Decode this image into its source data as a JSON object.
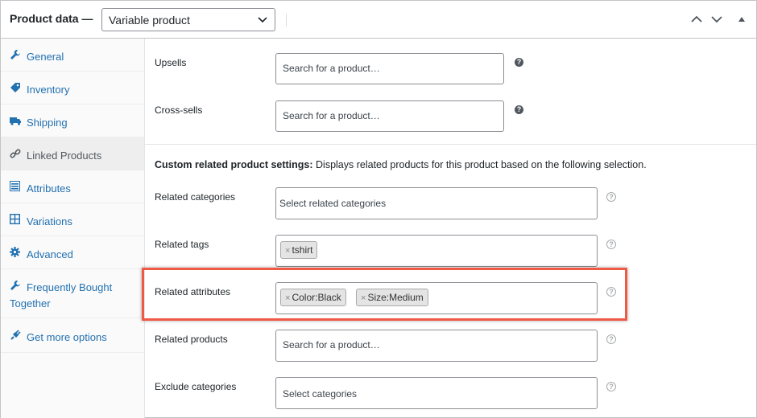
{
  "header": {
    "title": "Product data —",
    "product_type": "Variable product"
  },
  "sidebar": {
    "items": [
      {
        "label": "General",
        "icon": "wrench-icon",
        "active": false
      },
      {
        "label": "Inventory",
        "icon": "tag-icon",
        "active": false
      },
      {
        "label": "Shipping",
        "icon": "truck-icon",
        "active": false
      },
      {
        "label": "Linked Products",
        "icon": "link-icon",
        "active": true
      },
      {
        "label": "Attributes",
        "icon": "list-icon",
        "active": false
      },
      {
        "label": "Variations",
        "icon": "grid-icon",
        "active": false
      },
      {
        "label": "Advanced",
        "icon": "gear-icon",
        "active": false
      },
      {
        "label": "Frequently Bought Together",
        "icon": "wrench-icon",
        "active": false
      },
      {
        "label": "Get more options",
        "icon": "plugin-icon",
        "active": false
      }
    ]
  },
  "main": {
    "upsells": {
      "label": "Upsells",
      "placeholder": "Search for a product…"
    },
    "cross_sells": {
      "label": "Cross-sells",
      "placeholder": "Search for a product…"
    },
    "notice_bold": "Custom related product settings:",
    "notice_text": " Displays related products for this product based on the following selection.",
    "related_categories": {
      "label": "Related categories",
      "placeholder": "Select related categories"
    },
    "related_tags": {
      "label": "Related tags",
      "chips": [
        "tshirt"
      ]
    },
    "related_attributes": {
      "label": "Related attributes",
      "chips": [
        "Color:Black",
        "Size:Medium"
      ]
    },
    "related_products": {
      "label": "Related products",
      "placeholder": "Search for a product…"
    },
    "exclude_categories": {
      "label": "Exclude categories",
      "placeholder": "Select categories"
    }
  },
  "colors": {
    "link": "#2271b1",
    "highlight": "#ef5a46"
  }
}
